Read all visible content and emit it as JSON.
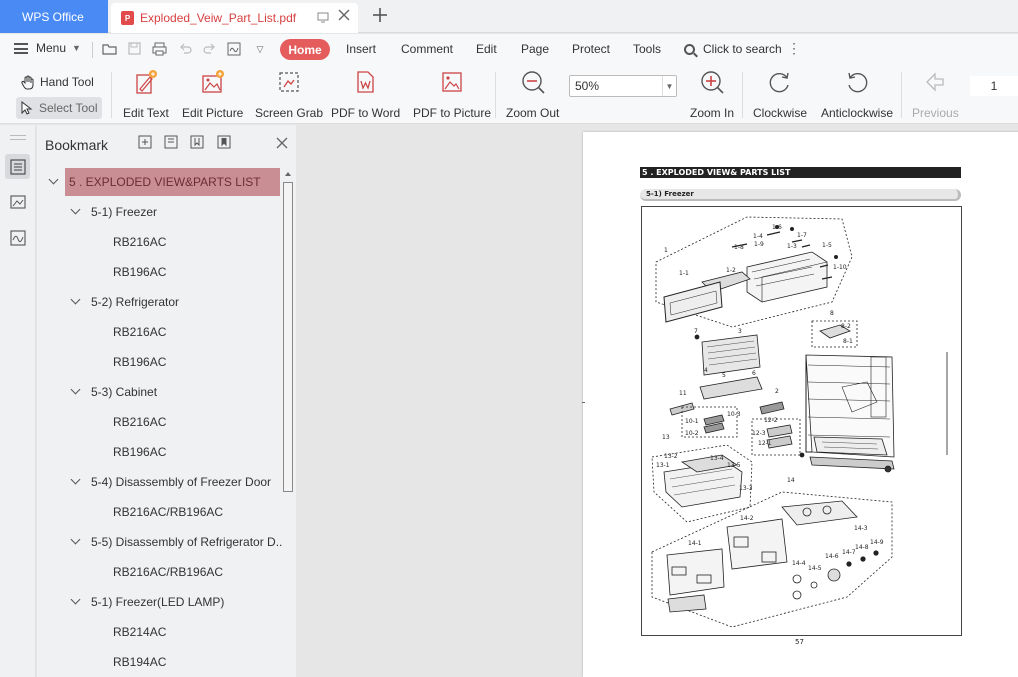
{
  "tabbar": {
    "app_label": "WPS Office",
    "doc_tab_title": "Exploded_Veiw_Part_List.pdf",
    "pdf_badge": "P"
  },
  "menubar": {
    "menu_label": "Menu",
    "tabs": [
      "Home",
      "Insert",
      "Comment",
      "Edit",
      "Page",
      "Protect",
      "Tools"
    ],
    "active_tab": "Home",
    "search_label": "Click to search"
  },
  "ribbon": {
    "hand_tool": "Hand Tool",
    "select_tool": "Select Tool",
    "edit_text": "Edit Text",
    "edit_picture": "Edit Picture",
    "screen_grab": "Screen Grab",
    "pdf_to_word": "PDF to Word",
    "pdf_to_picture": "PDF to Picture",
    "zoom_out": "Zoom Out",
    "zoom_value": "50%",
    "zoom_in": "Zoom In",
    "clockwise": "Clockwise",
    "anticlockwise": "Anticlockwise",
    "previous": "Previous",
    "page_number": "1"
  },
  "bookmark": {
    "title": "Bookmark",
    "items": [
      {
        "label": "5 . EXPLODED VIEW&PARTS LIST",
        "level": 0,
        "selected": true
      },
      {
        "label": "5-1) Freezer",
        "level": 1
      },
      {
        "label": "RB216AC",
        "level": 2
      },
      {
        "label": "RB196AC",
        "level": 2
      },
      {
        "label": "5-2) Refrigerator",
        "level": 1
      },
      {
        "label": "RB216AC",
        "level": 2
      },
      {
        "label": "RB196AC",
        "level": 2
      },
      {
        "label": "5-3) Cabinet",
        "level": 1
      },
      {
        "label": "RB216AC",
        "level": 2
      },
      {
        "label": "RB196AC",
        "level": 2
      },
      {
        "label": "5-4) Disassembly of Freezer Door",
        "level": 1
      },
      {
        "label": "RB216AC/RB196AC",
        "level": 2
      },
      {
        "label": "5-5) Disassembly of Refrigerator D...",
        "level": 1
      },
      {
        "label": "RB216AC/RB196AC",
        "level": 2
      },
      {
        "label": "5-1) Freezer(LED LAMP)",
        "level": 1
      },
      {
        "label": "RB214AC",
        "level": 2
      },
      {
        "label": "RB194AC",
        "level": 2
      }
    ]
  },
  "document": {
    "header": "5 . EXPLODED VIEW& PARTS LIST",
    "subheader": "5-1) Freezer",
    "page_number": "57",
    "callouts": [
      "1",
      "1-1",
      "1-2",
      "1-3",
      "1-4",
      "1-5",
      "1-6",
      "1-7",
      "1-8",
      "1-9",
      "1-10",
      "2",
      "3",
      "4",
      "5",
      "6",
      "7",
      "8",
      "8-1",
      "8-2",
      "10-1",
      "10-2",
      "10-3",
      "11",
      "12-1",
      "12-2",
      "12-3",
      "13",
      "13-1",
      "13-2",
      "13-3",
      "13-4",
      "13-5",
      "14",
      "14-1",
      "14-2",
      "14-3",
      "14-4",
      "14-5",
      "14-6",
      "14-7",
      "14-8",
      "14-9"
    ]
  },
  "colors": {
    "brand_blue": "#4a8af4",
    "home_pill": "#e55c5c",
    "doc_tab_text": "#d84040",
    "bookmark_selected": "#c98e93"
  }
}
